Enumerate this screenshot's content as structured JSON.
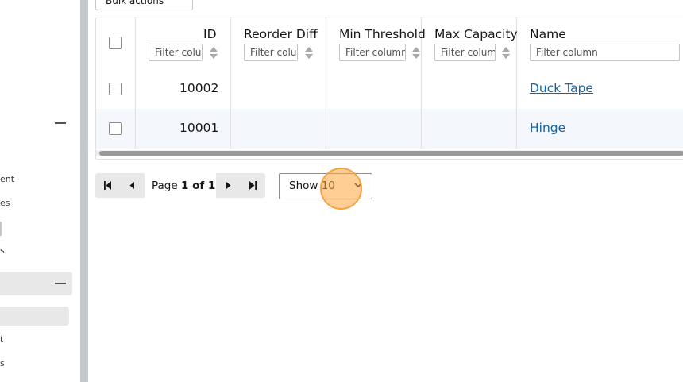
{
  "sidebar": {
    "items": [
      {
        "label": "ent"
      },
      {
        "label": "es"
      },
      {
        "label": "s"
      },
      {
        "label": "t"
      },
      {
        "label": "s"
      }
    ]
  },
  "toolbar": {
    "bulk_actions_label": "Bulk actions"
  },
  "table": {
    "columns": [
      {
        "key": "id",
        "label": "ID",
        "filter_placeholder": "Filter column"
      },
      {
        "key": "reorder_diff",
        "label": "Reorder Diff",
        "filter_placeholder": "Filter column"
      },
      {
        "key": "min_threshold",
        "label": "Min Threshold",
        "filter_placeholder": "Filter column"
      },
      {
        "key": "max_capacity",
        "label": "Max Capacity",
        "filter_placeholder": "Filter column"
      },
      {
        "key": "name",
        "label": "Name",
        "filter_placeholder": "Filter column"
      }
    ],
    "rows": [
      {
        "id": "10002",
        "name": "Duck Tape"
      },
      {
        "id": "10001",
        "name": "Hinge"
      }
    ]
  },
  "pagination": {
    "page_prefix": "Page",
    "page_value": "1 of 1",
    "show_label": "Show 10"
  },
  "colors": {
    "link": "#0f62a8",
    "accent_cursor": "#f5a342",
    "divider": "#c1c7cd"
  }
}
